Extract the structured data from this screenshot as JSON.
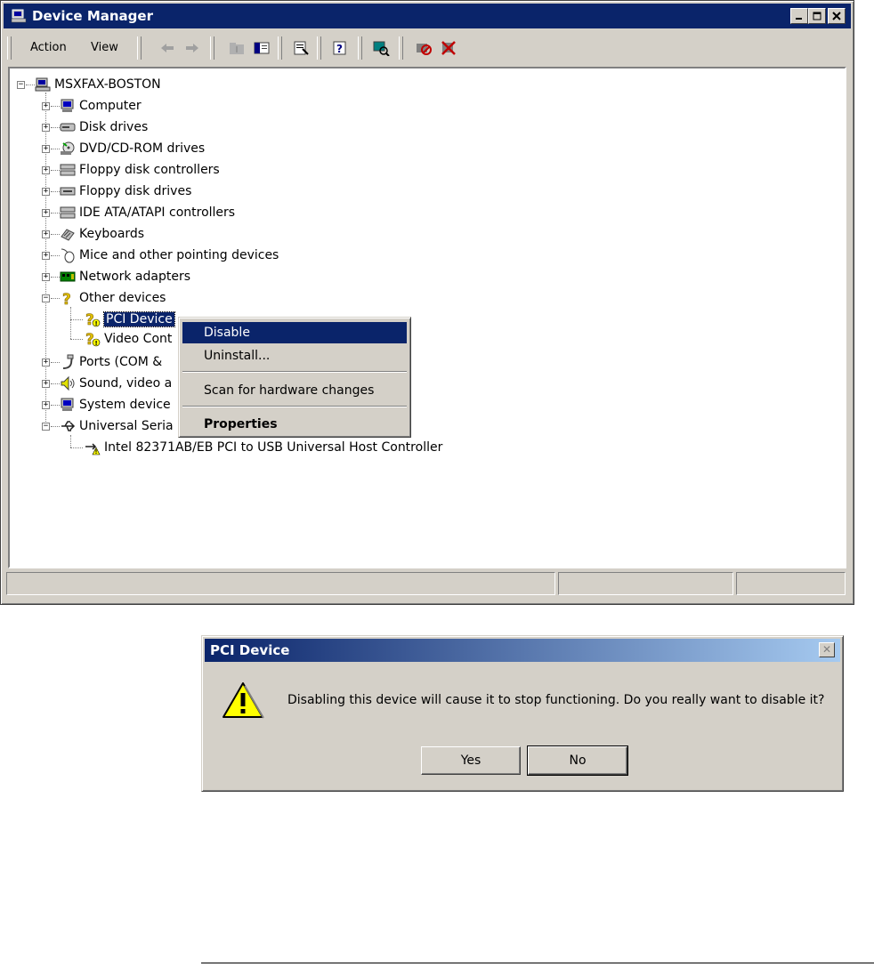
{
  "window": {
    "title": "Device Manager"
  },
  "menu": {
    "action": "Action",
    "view": "View"
  },
  "tree": {
    "root": "MSXFAX-BOSTON",
    "categories": [
      "Computer",
      "Disk drives",
      "DVD/CD-ROM drives",
      "Floppy disk controllers",
      "Floppy disk drives",
      "IDE ATA/ATAPI controllers",
      "Keyboards",
      "Mice and other pointing devices",
      "Network adapters",
      "Other devices"
    ],
    "other_children": [
      "PCI Device",
      "Video Cont"
    ],
    "categories_after": [
      "Ports (COM &",
      "Sound, video a",
      "System device",
      "Universal Seria"
    ],
    "usb_child": "Intel 82371AB/EB PCI to USB Universal Host Controller"
  },
  "context_menu": {
    "disable": "Disable",
    "uninstall": "Uninstall...",
    "scan": "Scan for hardware changes",
    "properties": "Properties"
  },
  "dialog": {
    "title": "PCI Device",
    "message": "Disabling this device will cause it to stop functioning. Do you really want to disable it?",
    "yes": "Yes",
    "no": "No",
    "close_glyph": "✕"
  },
  "colors": {
    "titlebar": "#0a246a",
    "face": "#d4d0c8",
    "warning": "#ffff00"
  }
}
